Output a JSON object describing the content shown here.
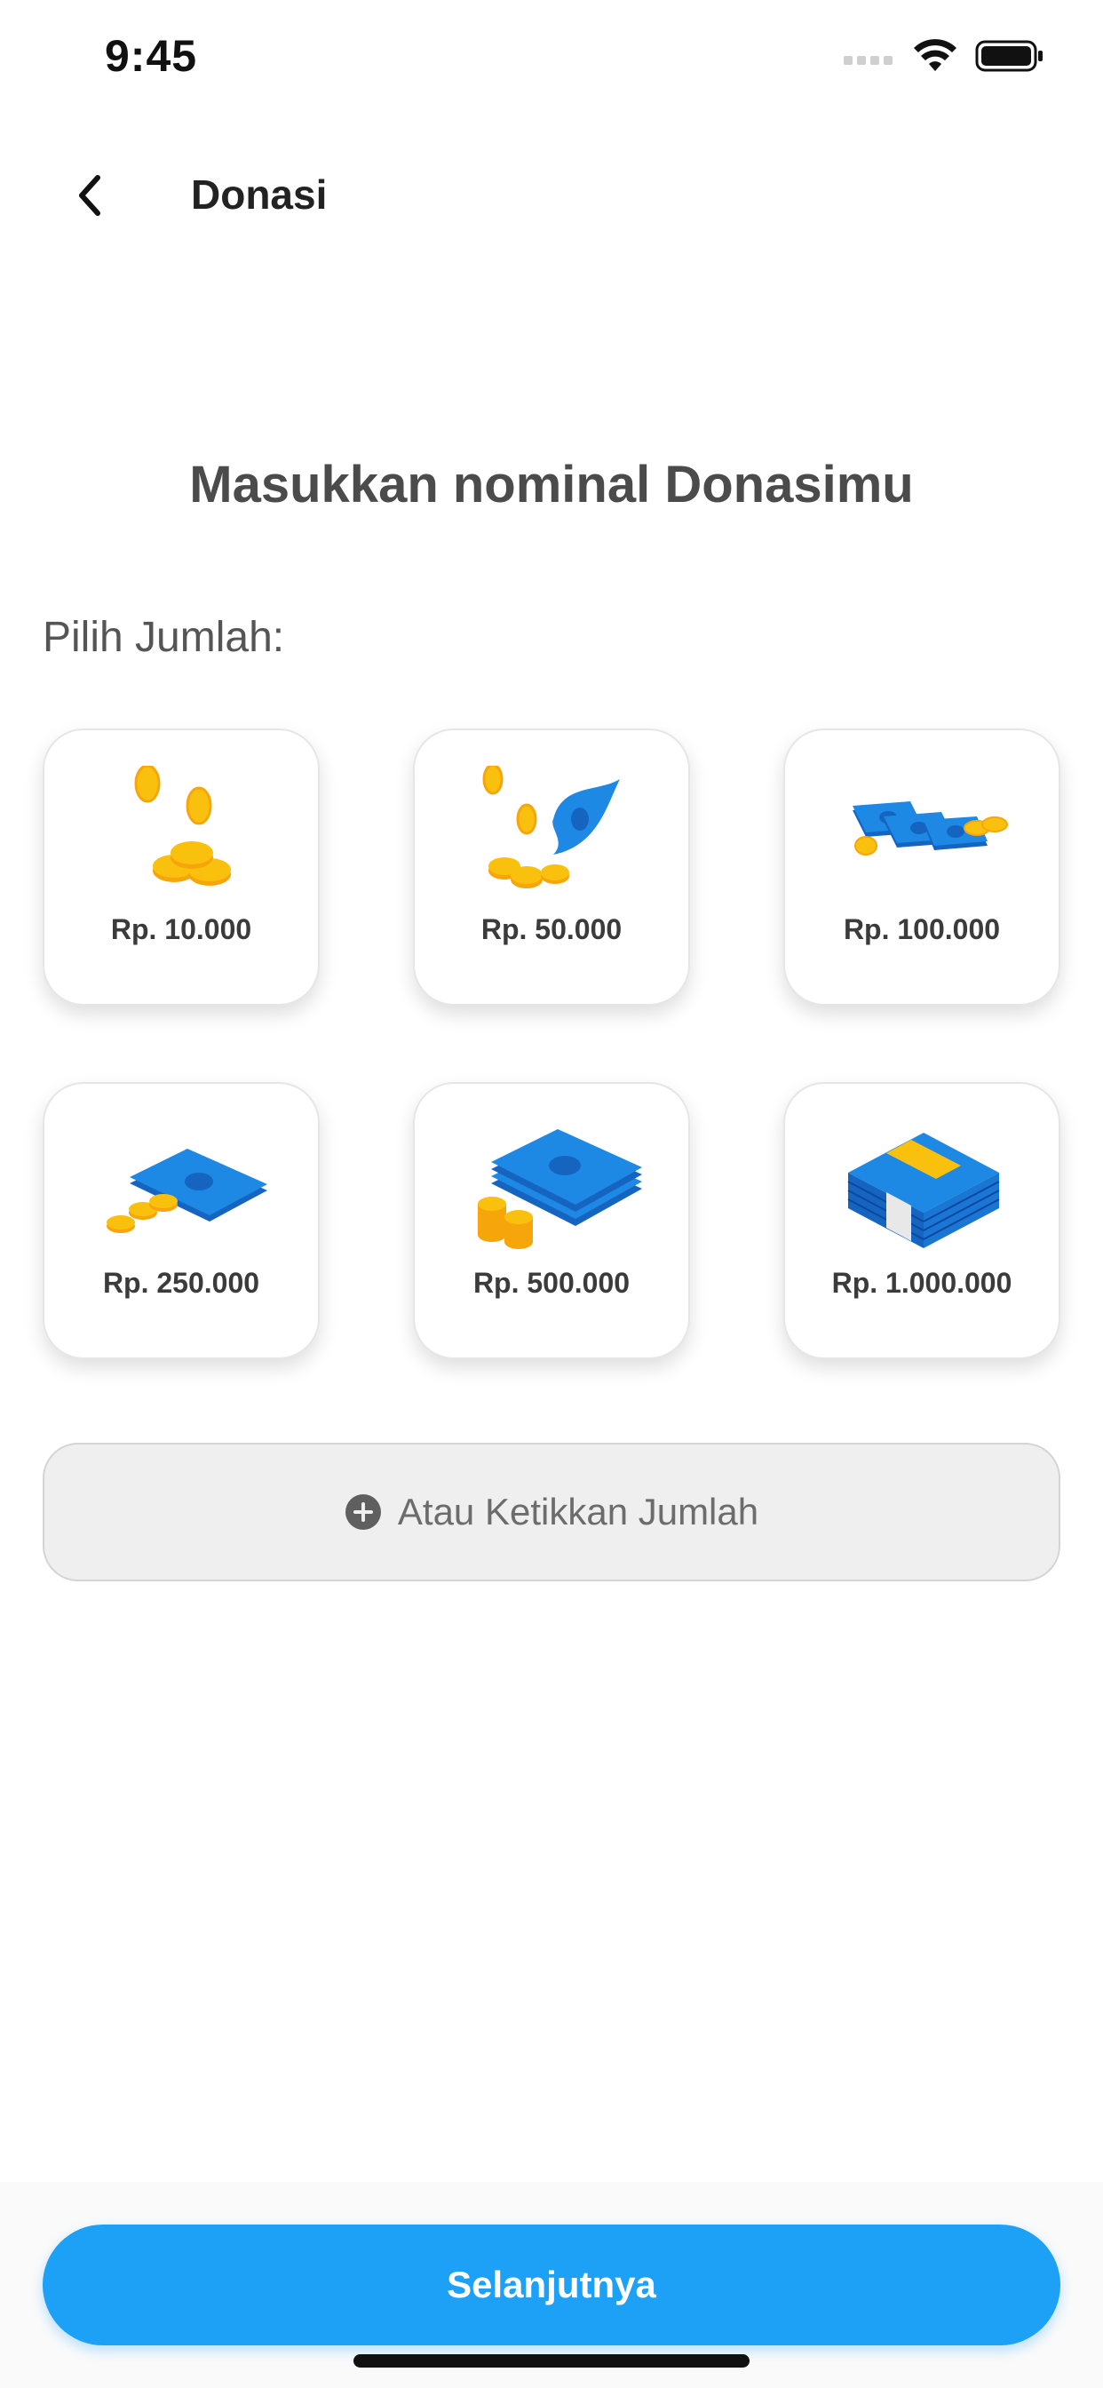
{
  "status_bar": {
    "time": "9:45"
  },
  "nav": {
    "title": "Donasi",
    "back_icon": "chevron-left-icon"
  },
  "main": {
    "heading": "Masukkan nominal Donasimu",
    "select_label": "Pilih Jumlah:",
    "amount_options": [
      {
        "label": "Rp. 10.000",
        "icon": "coins-icon"
      },
      {
        "label": "Rp. 50.000",
        "icon": "bill-with-coins-icon"
      },
      {
        "label": "Rp. 100.000",
        "icon": "bills-with-coins-icon"
      },
      {
        "label": "Rp. 250.000",
        "icon": "bill-with-coins-icon"
      },
      {
        "label": "Rp. 500.000",
        "icon": "bill-stack-with-coins-icon"
      },
      {
        "label": "Rp. 1.000.000",
        "icon": "banded-money-stack-icon"
      }
    ],
    "custom_amount_label": "Atau Ketikkan Jumlah",
    "custom_amount_icon": "plus-circle-icon"
  },
  "footer": {
    "next_label": "Selanjutnya"
  },
  "colors": {
    "accent": "#1da1f7",
    "bill": "#1e88e5",
    "coin": "#f9c10d",
    "text": "#4b4b4b"
  }
}
